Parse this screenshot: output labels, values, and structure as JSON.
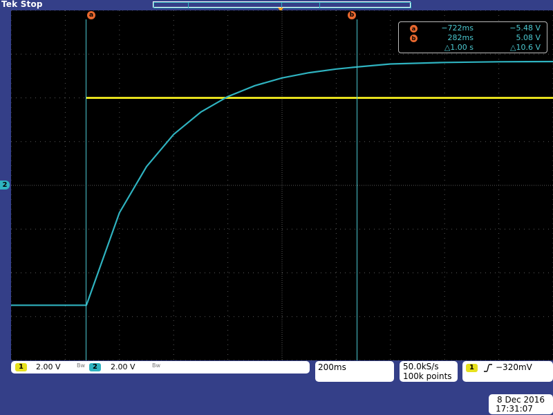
{
  "header": {
    "brand_label": "Tek Stop",
    "record_view": "record-length-indicator",
    "trigger_position_icon": "trigger-position-marker-icon"
  },
  "colors": {
    "ch1": "#e6e01d",
    "ch2": "#2fb3c0",
    "cursor": "#4cc9d1",
    "cursor_badge": "#e8682f",
    "frame": "#343f88",
    "screen": "#000000"
  },
  "cursor_markers": {
    "a": "a",
    "b": "b"
  },
  "ch2_ground_marker": "2",
  "cursor_readout": {
    "a": {
      "label": "a",
      "time": "−722ms",
      "value": "−5.48 V"
    },
    "b": {
      "label": "b",
      "time": "282ms",
      "value": "5.08 V"
    },
    "delta": {
      "time": "△1.00 s",
      "value": "△10.6 V"
    }
  },
  "channels": [
    {
      "badge": "1",
      "scale": "2.00 V",
      "bw": "Bw"
    },
    {
      "badge": "2",
      "scale": "2.00 V",
      "bw": "Bw"
    }
  ],
  "timebase": {
    "scale": "200ms"
  },
  "acquisition": {
    "rate": "50.0kS/s",
    "points": "100k points"
  },
  "trigger": {
    "source": "1",
    "slope_icon": "rising-edge-icon",
    "level": "−320mV"
  },
  "datetime": {
    "date": "8 Dec  2016",
    "time": "17:31:07"
  },
  "chart_data": {
    "type": "line",
    "title": "",
    "xlabel": "",
    "ylabel": "",
    "x_units": "ms",
    "y_units": "V",
    "xlim": [
      -1000,
      1000
    ],
    "ylim": [
      -8,
      8
    ],
    "grid": true,
    "series": [
      {
        "name": "1",
        "x": [
          -722,
          1000
        ],
        "y": [
          4.0,
          4.0
        ]
      },
      {
        "name": "2",
        "x": [
          -722,
          -600,
          -500,
          -400,
          -300,
          -200,
          -100,
          0,
          100,
          200,
          282,
          400,
          600,
          800,
          1000
        ],
        "y": [
          -5.48,
          -1.25,
          0.86,
          2.33,
          3.35,
          4.06,
          4.56,
          4.91,
          5.15,
          5.32,
          5.42,
          5.55,
          5.62,
          5.65,
          5.66
        ]
      }
    ],
    "cursors": {
      "a_ms": -722,
      "b_ms": 282
    }
  }
}
